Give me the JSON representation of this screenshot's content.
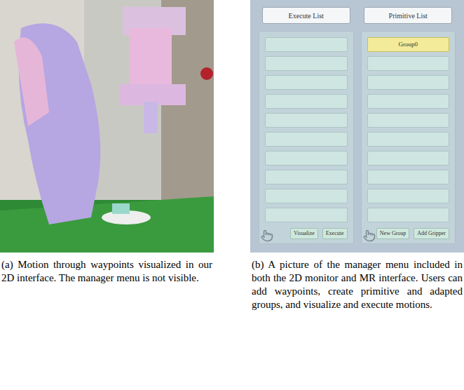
{
  "panel_a": {
    "caption": "(a) Motion through waypoints visualized in our 2D interface. The manager menu is not visible."
  },
  "panel_b": {
    "execute_list": {
      "title": "Execute List",
      "items": [
        {
          "label": "",
          "selected": false
        },
        {
          "label": "",
          "selected": false
        },
        {
          "label": "",
          "selected": false
        },
        {
          "label": "",
          "selected": false
        },
        {
          "label": "",
          "selected": false
        },
        {
          "label": "",
          "selected": false
        },
        {
          "label": "",
          "selected": false
        },
        {
          "label": "",
          "selected": false
        },
        {
          "label": "",
          "selected": false
        },
        {
          "label": "",
          "selected": false
        }
      ],
      "buttons": [
        "Visualize",
        "Execute"
      ]
    },
    "primitive_list": {
      "title": "Primitive List",
      "items": [
        {
          "label": "Group0",
          "selected": true
        },
        {
          "label": "",
          "selected": false
        },
        {
          "label": "",
          "selected": false
        },
        {
          "label": "",
          "selected": false
        },
        {
          "label": "",
          "selected": false
        },
        {
          "label": "",
          "selected": false
        },
        {
          "label": "",
          "selected": false
        },
        {
          "label": "",
          "selected": false
        },
        {
          "label": "",
          "selected": false
        },
        {
          "label": "",
          "selected": false
        }
      ],
      "buttons": [
        "New Group",
        "Add Gripper"
      ]
    },
    "caption": "(b) A picture of the manager menu included in both the 2D monitor and MR interface. Users can add waypoints, create primitive and adapted groups, and visualize and execute motions."
  }
}
